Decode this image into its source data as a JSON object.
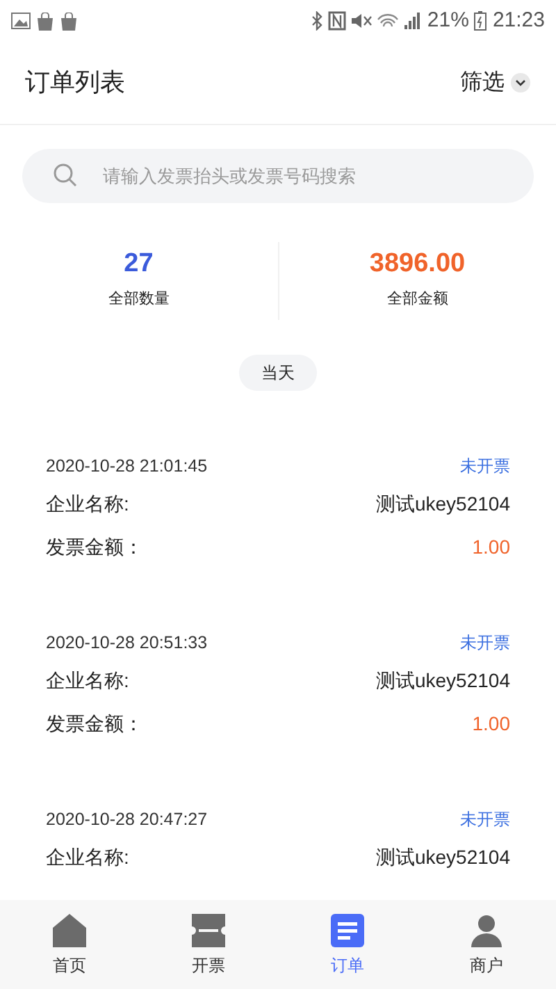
{
  "status_bar": {
    "battery": "21%",
    "time": "21:23"
  },
  "header": {
    "title": "订单列表",
    "filter": "筛选"
  },
  "search": {
    "placeholder": "请输入发票抬头或发票号码搜索"
  },
  "stats": [
    {
      "value": "27",
      "label": "全部数量",
      "color": "#3b5bdb"
    },
    {
      "value": "3896.00",
      "label": "全部金额",
      "color": "#f0632a"
    }
  ],
  "date_filter": "当天",
  "orders": [
    {
      "time": "2020-10-28 21:01:45",
      "status": "未开票",
      "company_label": "企业名称:",
      "company": "测试ukey52104",
      "amount_label": "发票金额：",
      "amount": "1.00"
    },
    {
      "time": "2020-10-28 20:51:33",
      "status": "未开票",
      "company_label": "企业名称:",
      "company": "测试ukey52104",
      "amount_label": "发票金额：",
      "amount": "1.00"
    },
    {
      "time": "2020-10-28 20:47:27",
      "status": "未开票",
      "company_label": "企业名称:",
      "company": "测试ukey52104"
    }
  ],
  "tab_bar": [
    {
      "label": "首页",
      "kind": "home",
      "selected": false
    },
    {
      "label": "开票",
      "kind": "ticket",
      "selected": false
    },
    {
      "label": "订单",
      "kind": "list",
      "selected": true
    },
    {
      "label": "商户",
      "kind": "person",
      "selected": false
    }
  ]
}
